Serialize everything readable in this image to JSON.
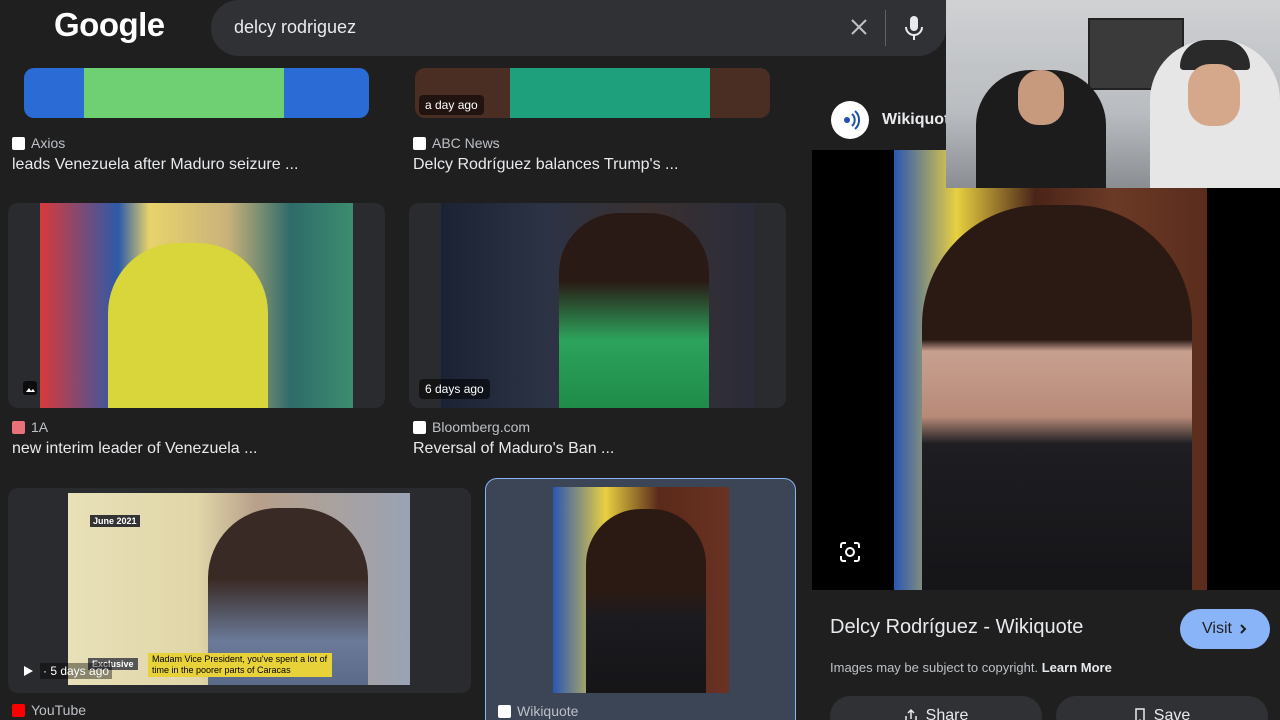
{
  "header": {
    "logo": "Google",
    "query": "delcy rodriguez"
  },
  "results": [
    {
      "source": "Axios",
      "title": "leads Venezuela after Maduro seizure ...",
      "fav_color": "#ffffff"
    },
    {
      "source": "ABC News",
      "title": "Delcy Rodríguez balances Trump's ...",
      "badge": "a day ago",
      "fav_color": "#ffffff"
    },
    {
      "source": "1A",
      "title": "new interim leader of Venezuela ...",
      "fav_color": "#e8727a"
    },
    {
      "source": "Bloomberg.com",
      "title": "Reversal of Maduro's Ban ...",
      "badge": "6 days ago",
      "fav_color": "#ffffff"
    },
    {
      "source": "YouTube",
      "badge": "· 5 days ago",
      "fav_color": "#ff0000",
      "caption_tag": "June 2021",
      "caption_exclusive": "Exclusive",
      "caption_sub": "Madam Vice President, you've spent a lot of time in the poorer parts of Caracas"
    },
    {
      "source": "Wikiquote",
      "fav_color": "#ffffff"
    }
  ],
  "panel": {
    "source": "Wikiquote",
    "title": "Delcy Rodríguez - Wikiquote",
    "visit_label": "Visit",
    "copyright": "Images may be subject to copyright.",
    "learn_more": "Learn More",
    "share_label": "Share",
    "save_label": "Save"
  },
  "colors": {
    "accent": "#8ab4f8",
    "background": "#1f1f1f"
  }
}
